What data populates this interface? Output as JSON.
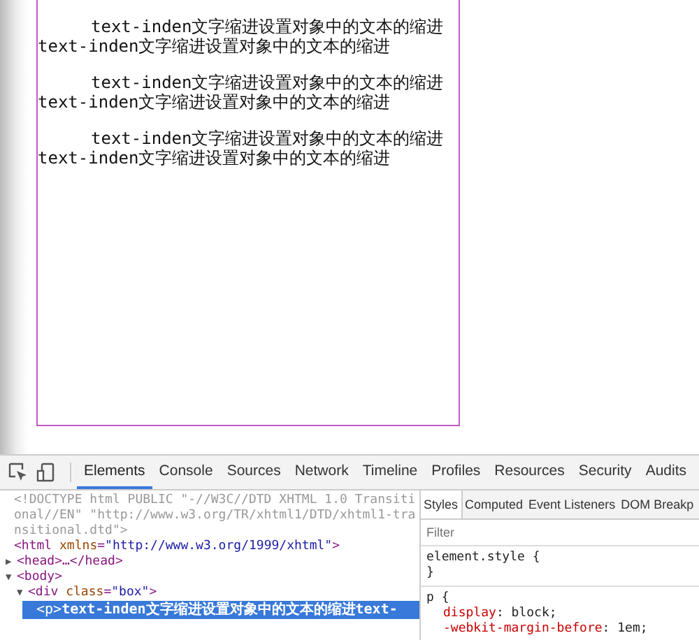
{
  "page": {
    "paragraphs": [
      {
        "lines": [
          "text-inden文字缩进设置对象中的文本的缩进",
          "text-inden文字缩进设置对象中的文本的缩进"
        ]
      },
      {
        "lines": [
          "text-inden文字缩进设置对象中的文本的缩进",
          "text-inden文字缩进设置对象中的文本的缩进"
        ]
      },
      {
        "lines": [
          "text-inden文字缩进设置对象中的文本的缩进",
          "text-inden文字缩进设置对象中的文本的缩进"
        ]
      }
    ]
  },
  "devtools": {
    "tabs": [
      {
        "label": "Elements",
        "selected": true
      },
      {
        "label": "Console",
        "selected": false
      },
      {
        "label": "Sources",
        "selected": false
      },
      {
        "label": "Network",
        "selected": false
      },
      {
        "label": "Timeline",
        "selected": false
      },
      {
        "label": "Profiles",
        "selected": false
      },
      {
        "label": "Resources",
        "selected": false
      },
      {
        "label": "Security",
        "selected": false
      },
      {
        "label": "Audits",
        "selected": false
      }
    ],
    "dom_tree": [
      {
        "parts": [
          {
            "kind": "doctype",
            "text": "<!DOCTYPE html PUBLIC \"-//W3C//DTD XHTML 1.0 Transitional//EN\" \"http://www.w3.org/TR/xhtml1/DTD/xhtml1-transitional.dtd\">"
          }
        ],
        "selected": false
      },
      {
        "parts": [
          {
            "kind": "tag",
            "text": "<html "
          },
          {
            "kind": "attr",
            "text": "xmlns"
          },
          {
            "kind": "tag",
            "text": "="
          },
          {
            "kind": "value",
            "text": "\"http://www.w3.org/1999/xhtml\""
          },
          {
            "kind": "tag",
            "text": ">"
          }
        ],
        "selected": false
      },
      {
        "toggle": "▶",
        "parts": [
          {
            "kind": "tag",
            "text": "<head>…</head>"
          }
        ],
        "selected": false
      },
      {
        "toggle": "▼",
        "parts": [
          {
            "kind": "tag",
            "text": "<body>"
          }
        ],
        "selected": false,
        "children": [
          {
            "toggle": "▼",
            "parts": [
              {
                "kind": "tag",
                "text": "<div "
              },
              {
                "kind": "attr",
                "text": "class"
              },
              {
                "kind": "tag",
                "text": "="
              },
              {
                "kind": "value",
                "text": "\"box\""
              },
              {
                "kind": "tag",
                "text": ">"
              }
            ],
            "selected": false,
            "children": [
              {
                "parts": [
                  {
                    "kind": "tag",
                    "text": "<p>"
                  },
                  {
                    "kind": "text",
                    "text": "text-inden文字缩进设置对象中的文本的缩进text-"
                  }
                ],
                "selected": true
              }
            ]
          }
        ]
      }
    ],
    "styles_tabs": [
      {
        "label": "Styles",
        "selected": true
      },
      {
        "label": "Computed",
        "selected": false
      },
      {
        "label": "Event Listeners",
        "selected": false
      },
      {
        "label": "DOM Breakp",
        "selected": false
      }
    ],
    "filter": {
      "placeholder": "Filter"
    },
    "rules": [
      {
        "selector": "element.style {",
        "close": "}"
      },
      {
        "selector": "p {",
        "props": [
          {
            "name": "display",
            "sep": ": ",
            "value": "block;"
          },
          {
            "name": "-webkit-margin-before",
            "sep": ": ",
            "value": "1em;"
          }
        ]
      }
    ]
  }
}
